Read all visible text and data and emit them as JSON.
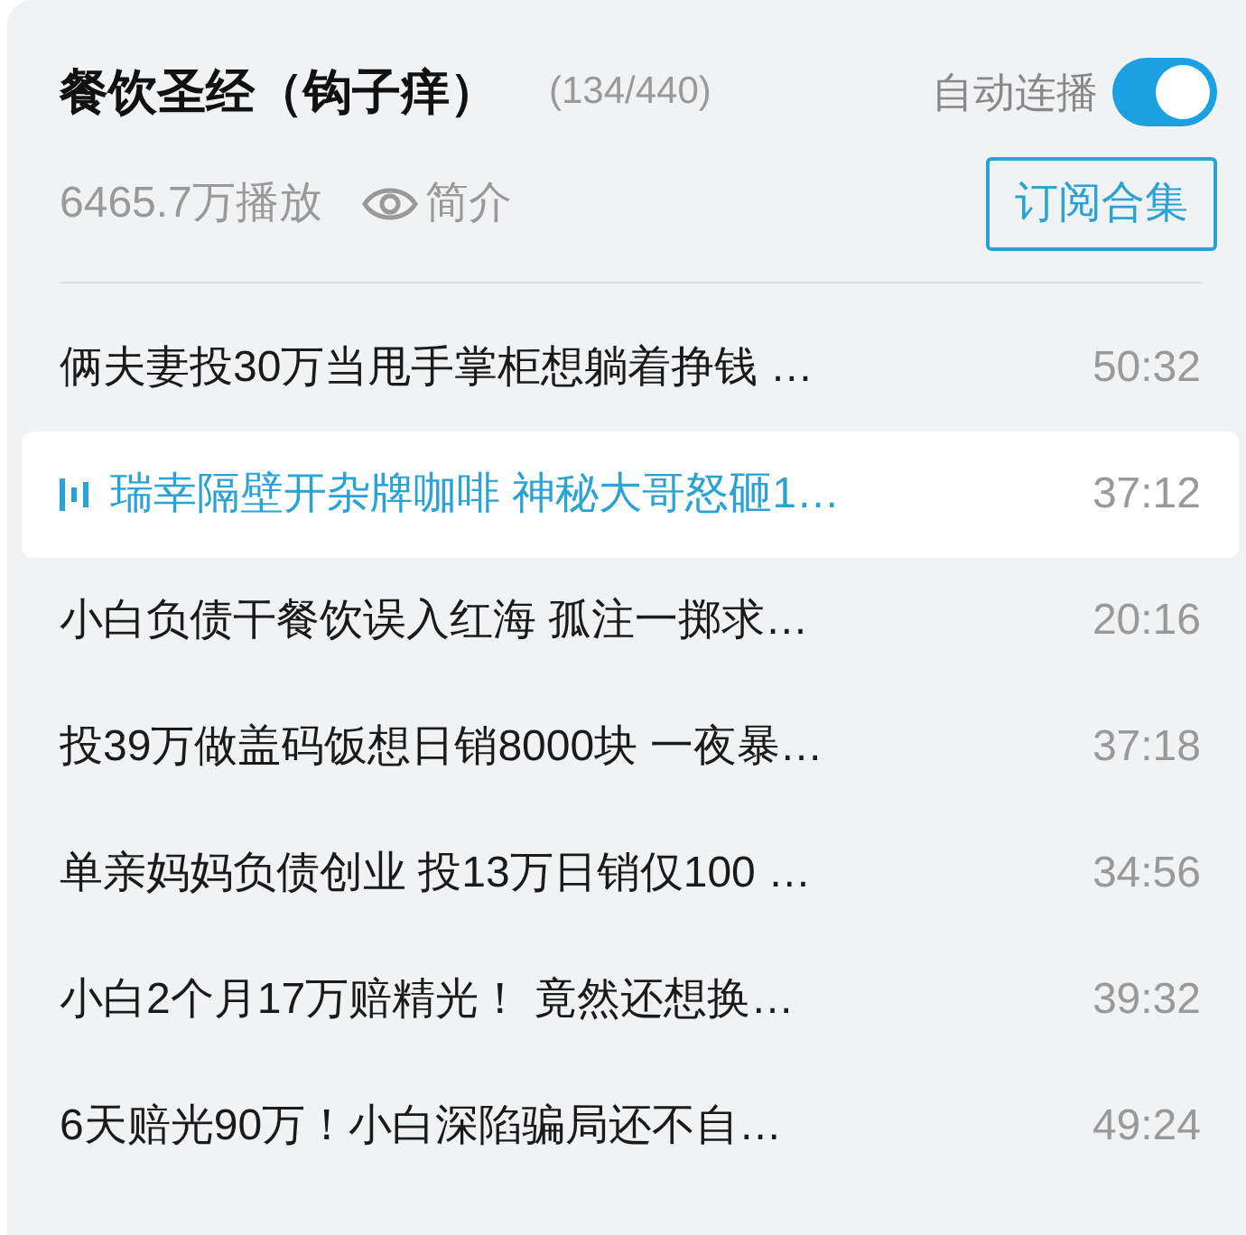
{
  "header": {
    "title": "餐饮圣经（钩子痒）",
    "progress": "(134/440)",
    "autoplay_label": "自动连播",
    "autoplay_on": true,
    "plays": "6465.7万播放",
    "intro_link": "简介",
    "subscribe_button": "订阅合集"
  },
  "episodes": [
    {
      "title": "俩夫妻投30万当甩手掌柜想躺着挣钱 …",
      "duration": "50:32",
      "selected": false
    },
    {
      "title": "瑞幸隔壁开杂牌咖啡 神秘大哥怒砸1…",
      "duration": "37:12",
      "selected": true
    },
    {
      "title": "小白负债干餐饮误入红海 孤注一掷求…",
      "duration": "20:16",
      "selected": false
    },
    {
      "title": "投39万做盖码饭想日销8000块 一夜暴…",
      "duration": "37:18",
      "selected": false
    },
    {
      "title": "单亲妈妈负债创业 投13万日销仅100 …",
      "duration": "34:56",
      "selected": false
    },
    {
      "title": "小白2个月17万赔精光！ 竟然还想换…",
      "duration": "39:32",
      "selected": false
    },
    {
      "title": "6天赔光90万！小白深陷骗局还不自…",
      "duration": "49:24",
      "selected": false
    }
  ]
}
